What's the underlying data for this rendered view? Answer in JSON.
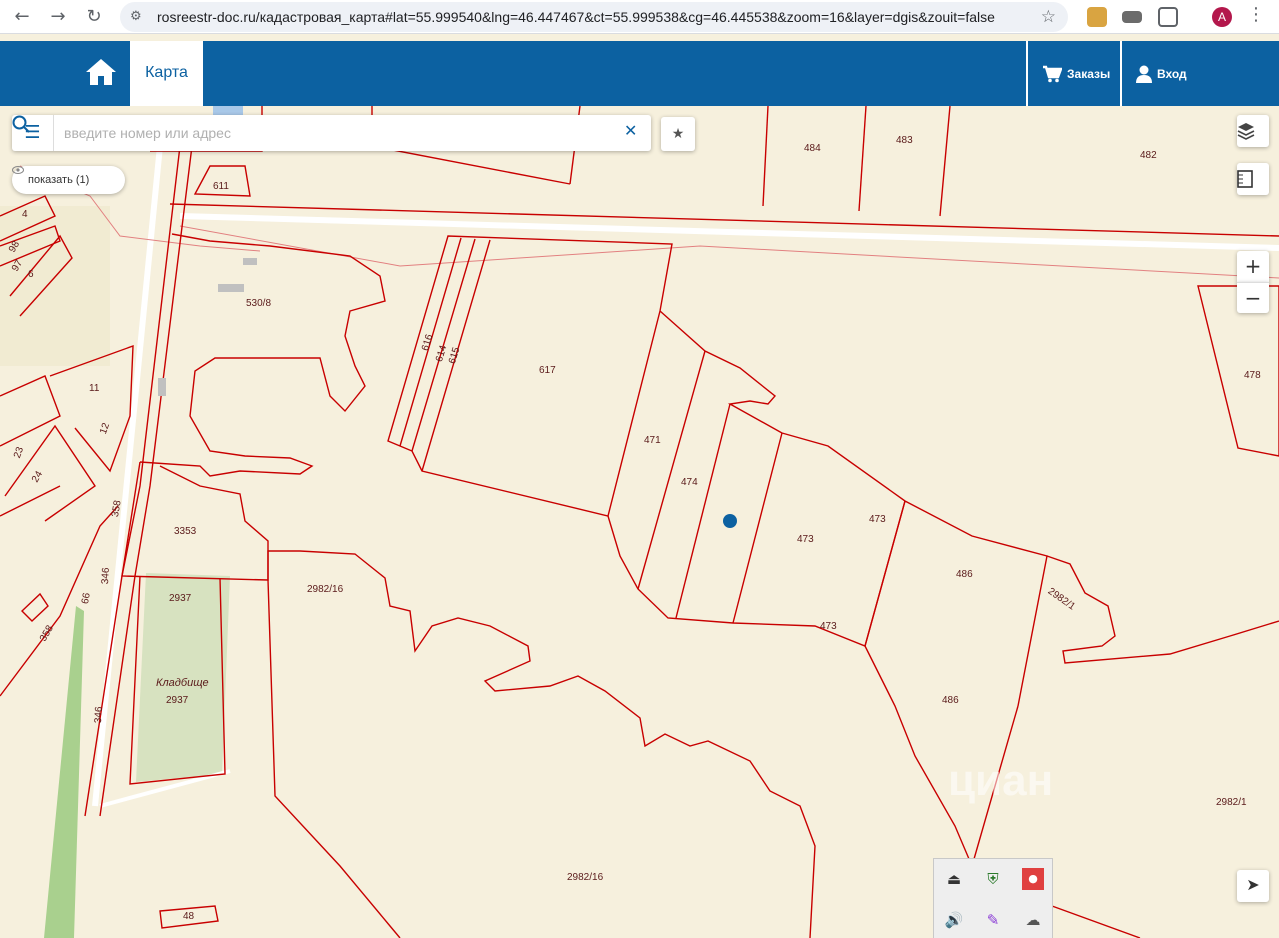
{
  "browser": {
    "url": "rosreestr-doc.ru/кадастровая_карта#lat=55.999540&lng=46.447467&ct=55.999538&cg=46.445538&zoom=16&layer=dgis&zouit=false",
    "avatar_letter": "A"
  },
  "header": {
    "map_tab": "Карта",
    "orders": "Заказы",
    "login": "Вход",
    "brand_color": "#0c61a1"
  },
  "search": {
    "placeholder": "введите номер или адрес"
  },
  "show_button": "показать (1)",
  "map_controls": {
    "zoom_in": "+",
    "zoom_out": "−"
  },
  "plots": [
    {
      "id": "p484",
      "label": "484"
    },
    {
      "id": "p483",
      "label": "483"
    },
    {
      "id": "p482",
      "label": "482"
    },
    {
      "id": "p611",
      "label": "611"
    },
    {
      "id": "p530",
      "label": "530/8"
    },
    {
      "id": "p617",
      "label": "617"
    },
    {
      "id": "p616",
      "label": "616"
    },
    {
      "id": "p614",
      "label": "614"
    },
    {
      "id": "p615",
      "label": "615"
    },
    {
      "id": "p471",
      "label": "471"
    },
    {
      "id": "p474",
      "label": "474"
    },
    {
      "id": "p473a",
      "label": "473"
    },
    {
      "id": "p473b",
      "label": "473"
    },
    {
      "id": "p473c",
      "label": "473"
    },
    {
      "id": "p486a",
      "label": "486"
    },
    {
      "id": "p486b",
      "label": "486"
    },
    {
      "id": "p2982_1a",
      "label": "2982/1"
    },
    {
      "id": "p2982_1b",
      "label": "2982/1"
    },
    {
      "id": "p478",
      "label": "478"
    },
    {
      "id": "p3353",
      "label": "3353"
    },
    {
      "id": "p2982_16a",
      "label": "2982/16"
    },
    {
      "id": "p2982_16b",
      "label": "2982/16"
    },
    {
      "id": "p2937a",
      "label": "2937"
    },
    {
      "id": "p2937b",
      "label": "2937"
    },
    {
      "id": "cemetery",
      "label": "Кладбище"
    },
    {
      "id": "p358a",
      "label": "358"
    },
    {
      "id": "p358b",
      "label": "358"
    },
    {
      "id": "p346a",
      "label": "346"
    },
    {
      "id": "p346b",
      "label": "346"
    },
    {
      "id": "p66",
      "label": "66"
    },
    {
      "id": "p48",
      "label": "48"
    },
    {
      "id": "p11",
      "label": "11"
    },
    {
      "id": "p12",
      "label": "12"
    },
    {
      "id": "p23",
      "label": "23"
    },
    {
      "id": "p24",
      "label": "24"
    },
    {
      "id": "p4",
      "label": "4"
    },
    {
      "id": "p98",
      "label": "98"
    },
    {
      "id": "p97",
      "label": "97"
    },
    {
      "id": "p6",
      "label": "6"
    }
  ],
  "watermark": "циан"
}
